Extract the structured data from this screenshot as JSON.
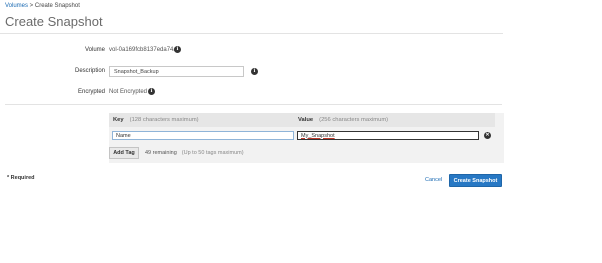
{
  "breadcrumb": {
    "parent": "Volumes",
    "separator": " > ",
    "current": "Create Snapshot"
  },
  "page_title": "Create Snapshot",
  "form": {
    "volume_label": "Volume",
    "volume_value": "vol-0a169fcb8137eda74a",
    "description_label": "Description",
    "description_value": "Snapshot_Backup",
    "encrypted_label": "Encrypted",
    "encrypted_value": "Not Encrypted"
  },
  "tags": {
    "key_header": "Key",
    "key_hint": "(128 characters maximum)",
    "value_header": "Value",
    "value_hint": "(256 characters maximum)",
    "rows": [
      {
        "key": "Name",
        "value": "My_Snapshot"
      }
    ],
    "add_label": "Add Tag",
    "remaining": "49 remaining",
    "remaining_hint": "(Up to 50 tags maximum)"
  },
  "footer": {
    "required": "* Required",
    "cancel": "Cancel",
    "create": "Create Snapshot"
  },
  "icons": {
    "info": "info-icon",
    "remove": "remove-icon"
  },
  "colors": {
    "primary_button": "#2778c4",
    "link": "#1a6ab3"
  }
}
